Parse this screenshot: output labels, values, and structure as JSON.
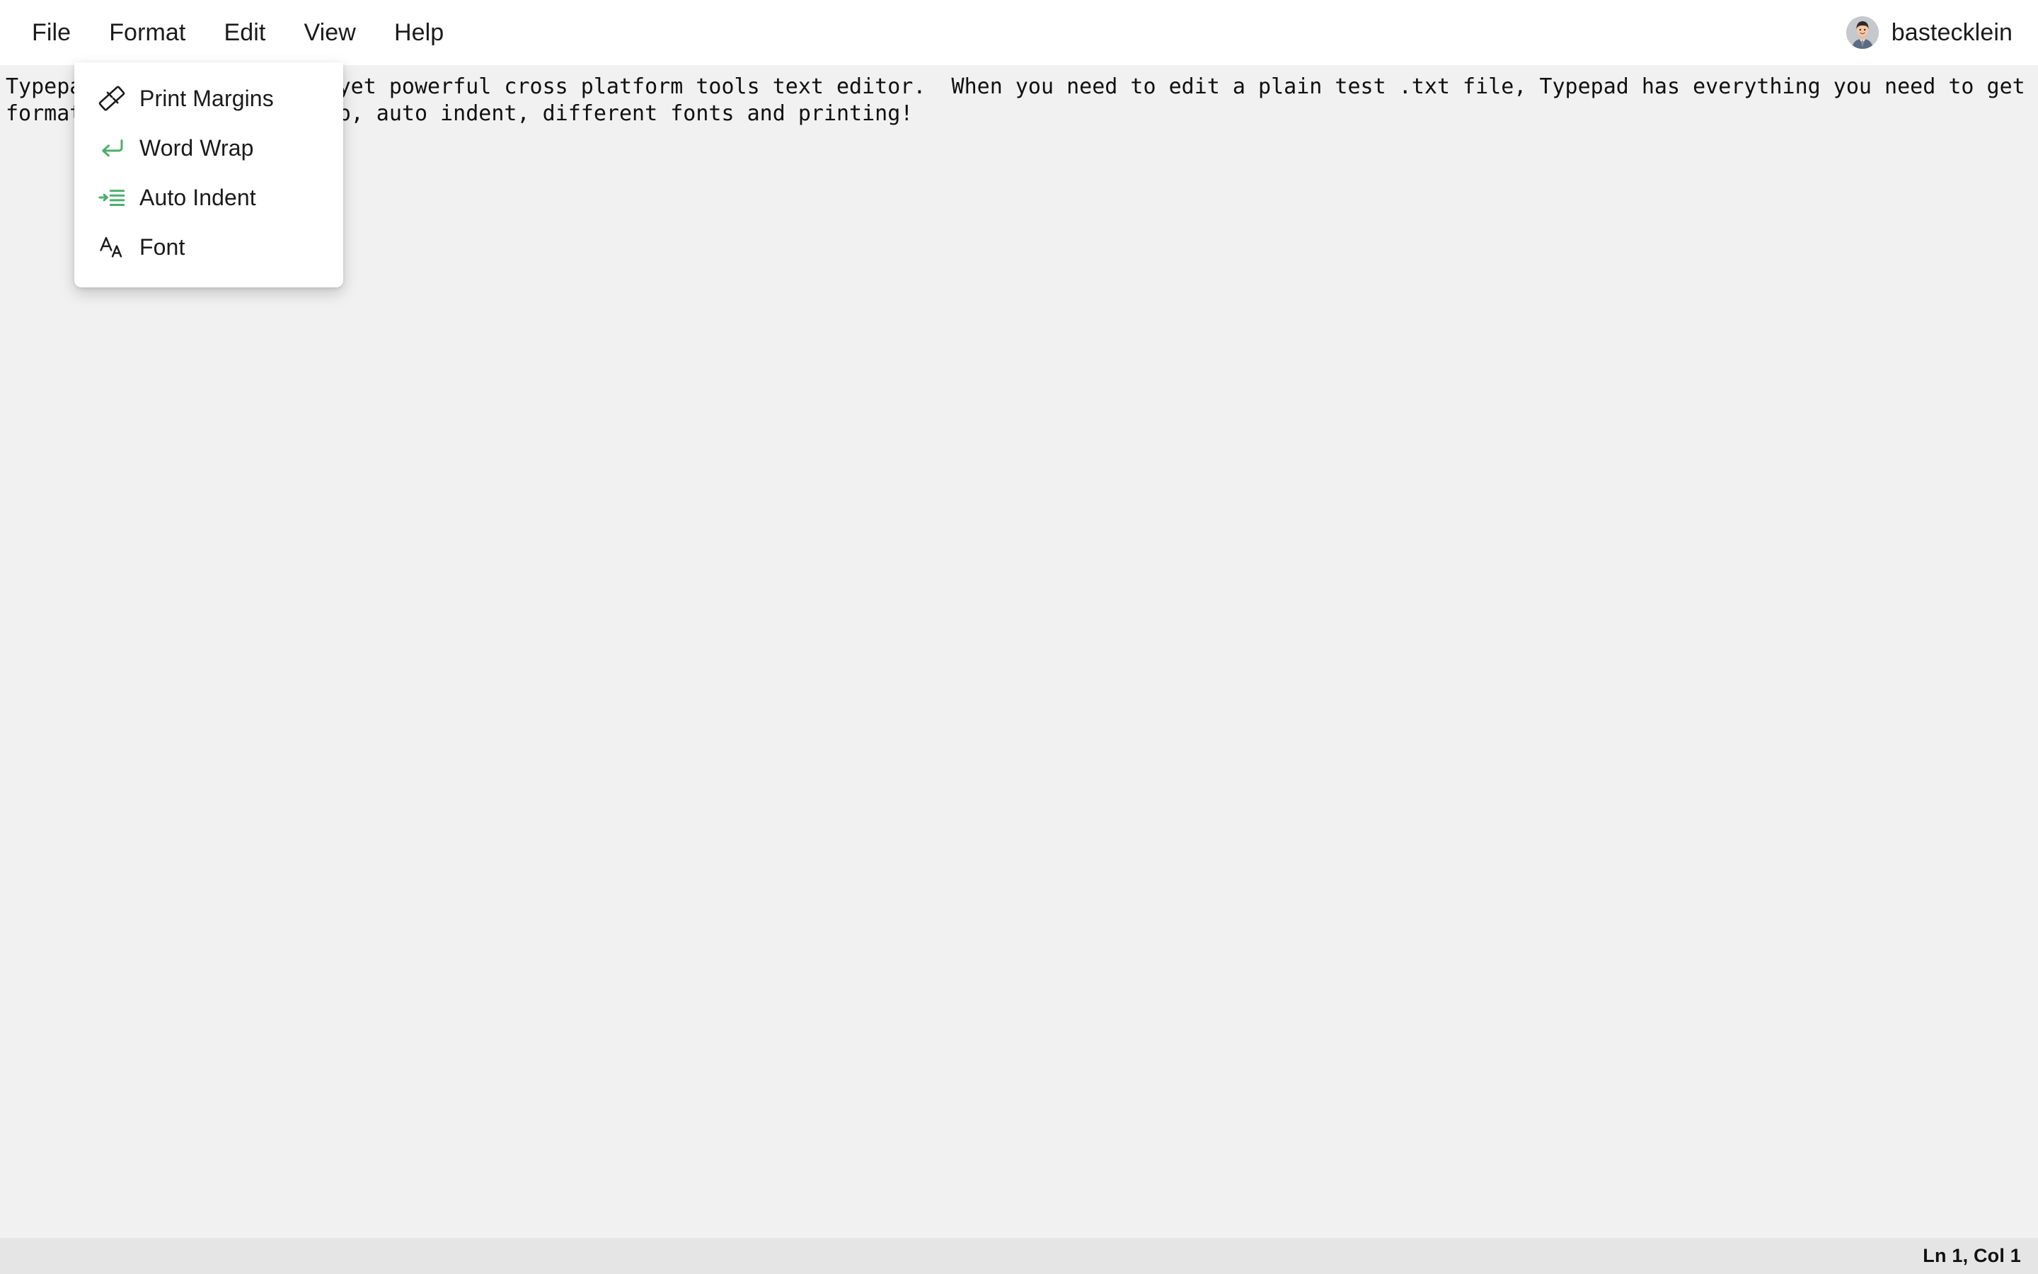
{
  "app": {
    "name": "Typepad",
    "background_color": "#f1f1f1",
    "menubar_color": "#ffffff",
    "statusbar_color": "#e5e5e5",
    "accent_green": "#4caf6d"
  },
  "menubar": {
    "items": [
      {
        "label": "File",
        "name": "menu-file",
        "active": false
      },
      {
        "label": "Format",
        "name": "menu-format",
        "active": true
      },
      {
        "label": "Edit",
        "name": "menu-edit",
        "active": false
      },
      {
        "label": "View",
        "name": "menu-view",
        "active": false
      },
      {
        "label": "Help",
        "name": "menu-help",
        "active": false
      }
    ],
    "user": {
      "username": "bastecklein",
      "avatar_icon": "user-avatar-icon"
    }
  },
  "format_menu": {
    "open": true,
    "items": [
      {
        "label": "Print Margins",
        "icon": "ruler-icon",
        "icon_color": "#1b1b1b"
      },
      {
        "label": "Word Wrap",
        "icon": "return-arrow-icon",
        "icon_color": "#4caf6d"
      },
      {
        "label": "Auto Indent",
        "icon": "indent-increase-icon",
        "icon_color": "#4caf6d"
      },
      {
        "label": "Font",
        "icon": "font-size-icon",
        "icon_color": "#1b1b1b"
      }
    ]
  },
  "editor": {
    "line1": "Typepad is a minimalistic yet powerful cross platform tools text editor.  When you need to edit a plain test .txt file, Typepad has everything you need to get the job done.  Can read most text",
    "line2": "formats, supports word wrap, auto indent, different fonts and printing!"
  },
  "statusbar": {
    "cursor_position": "Ln 1, Col 1"
  }
}
